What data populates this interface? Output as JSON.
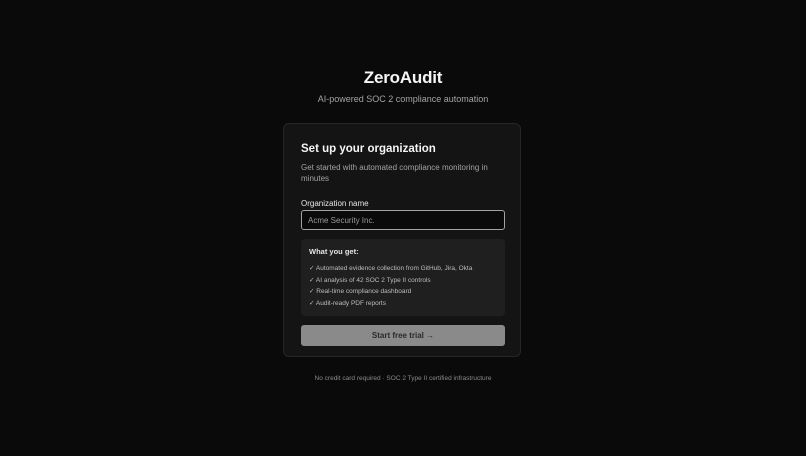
{
  "brand": {
    "name": "ZeroAudit",
    "tagline": "AI-powered SOC 2 compliance automation"
  },
  "card": {
    "title": "Set up your organization",
    "subtitle": "Get started with automated compliance monitoring in minutes",
    "org_field": {
      "label": "Organization name",
      "value": "",
      "placeholder": "Acme Security Inc."
    },
    "benefits": {
      "title": "What you get:",
      "items": [
        "✓ Automated evidence collection from GitHub, Jira, Okta",
        "✓ AI analysis of 42 SOC 2 Type II controls",
        "✓ Real-time compliance dashboard",
        "✓ Audit-ready PDF reports"
      ]
    },
    "cta_label": "Start free trial →"
  },
  "footnote": "No credit card required · SOC 2 Type II certified infrastructure",
  "colors": {
    "background": "#0a0a0a",
    "card": "#141414",
    "button": "#8a8a8a"
  }
}
